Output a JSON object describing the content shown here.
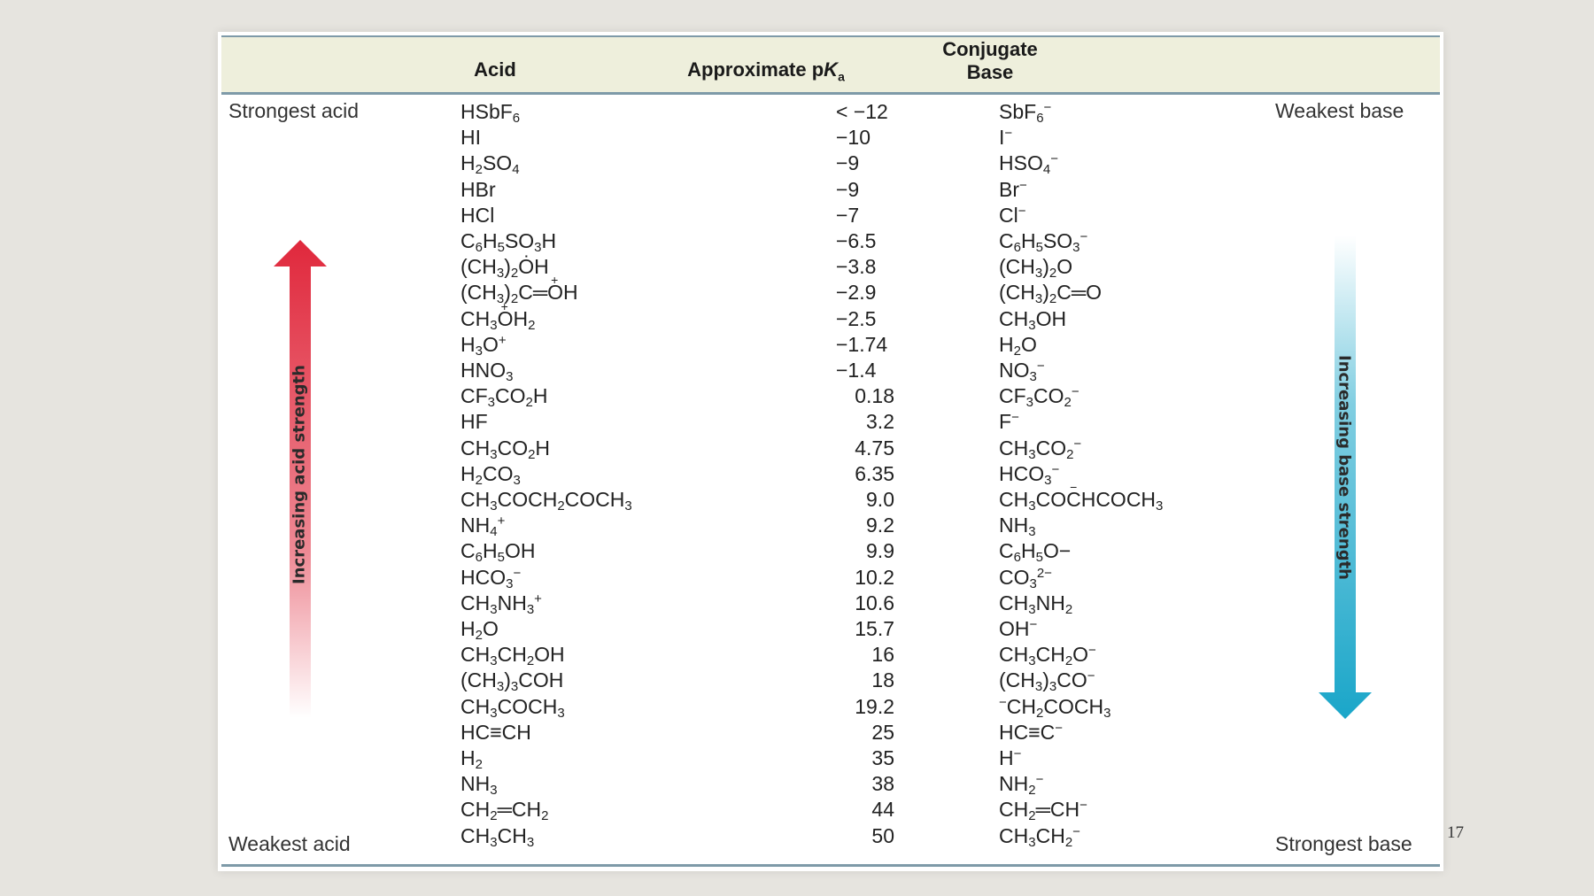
{
  "table": {
    "headers": {
      "acid": "Acid",
      "pka_text": "Approximate p",
      "pka_k": "K",
      "pka_sub": "a",
      "base_line1": "Conjugate",
      "base_line2": "Base"
    },
    "labels": {
      "strongest_acid": "Strongest acid",
      "weakest_acid": "Weakest acid",
      "weakest_base": "Weakest base",
      "strongest_base": "Strongest base"
    },
    "arrows": {
      "acid_strength": "Increasing acid strength",
      "base_strength": "Increasing base strength",
      "acid_color": "#e0283c",
      "base_color": "#1aa6c9"
    },
    "rows": [
      {
        "acid": "HSbF<sub>6</sub>",
        "pka": "< −12",
        "base": "SbF<sub>6</sub><sup>−</sup>"
      },
      {
        "acid": "HI",
        "pka": "−10",
        "base": "I<sup>−</sup>"
      },
      {
        "acid": "H<sub>2</sub>SO<sub>4</sub>",
        "pka": "−9",
        "base": "HSO<sub>4</sub><sup>−</sup>"
      },
      {
        "acid": "HBr",
        "pka": "−9",
        "base": "Br<sup>−</sup>"
      },
      {
        "acid": "HCl",
        "pka": "−7",
        "base": "Cl<sup>−</sup>"
      },
      {
        "acid": "C<sub>6</sub>H<sub>5</sub>SO<sub>3</sub>H",
        "pka": "−6.5",
        "base": "C<sub>6</sub>H<sub>5</sub>SO<sub>3</sub><sup>−</sup>"
      },
      {
        "acid": "(CH<sub>3</sub>)<sub>2</sub>O&#x0307;H",
        "pka": "−3.8",
        "base": "(CH<sub>3</sub>)<sub>2</sub>O"
      },
      {
        "acid": "(CH<sub>3</sub>)<sub>2</sub>C═<span class='plus'>O</span>H",
        "pka": "−2.9",
        "base": "(CH<sub>3</sub>)<sub>2</sub>C═O"
      },
      {
        "acid": "CH<sub>3</sub><span class='plus'>O</span>H<sub>2</sub>",
        "pka": "−2.5",
        "base": "CH<sub>3</sub>OH"
      },
      {
        "acid": "H<sub>3</sub>O<sup>+</sup>",
        "pka": "−1.74",
        "base": "H<sub>2</sub>O"
      },
      {
        "acid": "HNO<sub>3</sub>",
        "pka": "−1.4",
        "base": "NO<sub>3</sub><sup>−</sup>"
      },
      {
        "acid": "CF<sub>3</sub>CO<sub>2</sub>H",
        "pka": "0.18",
        "base": "CF<sub>3</sub>CO<sub>2</sub><sup>−</sup>"
      },
      {
        "acid": "HF",
        "pka": "3.2",
        "base": "F<sup>−</sup>"
      },
      {
        "acid": "CH<sub>3</sub>CO<sub>2</sub>H",
        "pka": "4.75",
        "base": "CH<sub>3</sub>CO<sub>2</sub><sup>−</sup>"
      },
      {
        "acid": "H<sub>2</sub>CO<sub>3</sub>",
        "pka": "6.35",
        "base": "HCO<sub>3</sub><sup>−</sup>"
      },
      {
        "acid": "CH<sub>3</sub>COCH<sub>2</sub>COCH<sub>3</sub>",
        "pka": "9.0",
        "base": "CH<sub>3</sub>CO<span class='minus'>C</span>HCOCH<sub>3</sub>"
      },
      {
        "acid": "NH<sub>4</sub><sup>+</sup>",
        "pka": "9.2",
        "base": "NH<sub>3</sub>"
      },
      {
        "acid": "C<sub>6</sub>H<sub>5</sub>OH",
        "pka": "9.9",
        "base": "C<sub>6</sub>H<sub>5</sub>O−"
      },
      {
        "acid": "HCO<sub>3</sub><sup>−</sup>",
        "pka": "10.2",
        "base": "CO<sub>3</sub><sup>2−</sup>"
      },
      {
        "acid": "CH<sub>3</sub>NH<sub>3</sub><sup>+</sup>",
        "pka": "10.6",
        "base": "CH<sub>3</sub>NH<sub>2</sub>"
      },
      {
        "acid": "H<sub>2</sub>O",
        "pka": "15.7",
        "base": "OH<sup>−</sup>"
      },
      {
        "acid": "CH<sub>3</sub>CH<sub>2</sub>OH",
        "pka": "16",
        "base": "CH<sub>3</sub>CH<sub>2</sub>O<sup>−</sup>"
      },
      {
        "acid": "(CH<sub>3</sub>)<sub>3</sub>COH",
        "pka": "18",
        "base": "(CH<sub>3</sub>)<sub>3</sub>CO<sup>−</sup>"
      },
      {
        "acid": "CH<sub>3</sub>COCH<sub>3</sub>",
        "pka": "19.2",
        "base": "<sup>−</sup>CH<sub>2</sub>COCH<sub>3</sub>"
      },
      {
        "acid": "HC≡CH",
        "pka": "25",
        "base": "HC≡C<sup>−</sup>"
      },
      {
        "acid": "H<sub>2</sub>",
        "pka": "35",
        "base": "H<sup>−</sup>"
      },
      {
        "acid": "NH<sub>3</sub>",
        "pka": "38",
        "base": "NH<sub>2</sub><sup>−</sup>"
      },
      {
        "acid": "CH<sub>2</sub>═CH<sub>2</sub>",
        "pka": "44",
        "base": "CH<sub>2</sub>═CH<sup>−</sup>"
      },
      {
        "acid": "CH<sub>3</sub>CH<sub>3</sub>",
        "pka": "50",
        "base": "CH<sub>3</sub>CH<sub>2</sub><sup>−</sup>"
      }
    ]
  },
  "page_number": "17"
}
